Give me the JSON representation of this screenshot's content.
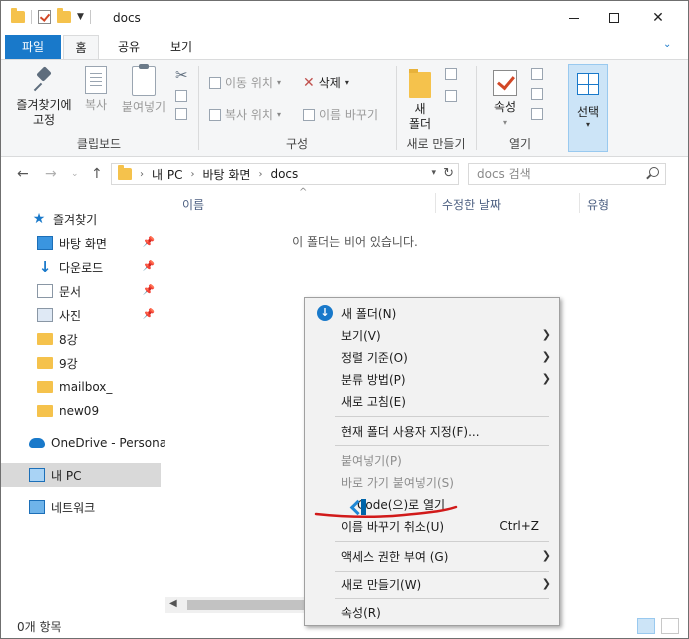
{
  "window": {
    "title": "docs"
  },
  "tabs": {
    "file": "파일",
    "home": "홈",
    "share": "공유",
    "view": "보기"
  },
  "ribbon": {
    "clipboard": {
      "group_label": "클립보드",
      "pin_label_line1": "즐겨찾기에",
      "pin_label_line2": "고정",
      "copy": "복사",
      "paste": "붙여넣기"
    },
    "organize": {
      "group_label": "구성",
      "move_to": "이동 위치",
      "copy_to": "복사 위치",
      "delete": "삭제",
      "rename": "이름 바꾸기"
    },
    "new": {
      "group_label": "새로 만들기",
      "new_folder_line1": "새",
      "new_folder_line2": "폴더"
    },
    "open": {
      "group_label": "열기",
      "properties": "속성"
    },
    "select": {
      "label": "선택"
    }
  },
  "address": {
    "path": [
      "내 PC",
      "바탕 화면",
      "docs"
    ],
    "search_placeholder": "docs 검색"
  },
  "navpane": {
    "quick_access": "즐겨찾기",
    "items": [
      {
        "label": "바탕 화면",
        "icon": "desktop-icon",
        "pinned": true
      },
      {
        "label": "다운로드",
        "icon": "download-icon",
        "pinned": true
      },
      {
        "label": "문서",
        "icon": "documents-icon",
        "pinned": true
      },
      {
        "label": "사진",
        "icon": "pictures-icon",
        "pinned": true
      },
      {
        "label": "8강",
        "icon": "folder-icon",
        "pinned": false
      },
      {
        "label": "9강",
        "icon": "folder-icon",
        "pinned": false
      },
      {
        "label": "mailbox_",
        "icon": "folder-icon",
        "pinned": false
      },
      {
        "label": "new09",
        "icon": "folder-icon",
        "pinned": false
      }
    ],
    "onedrive": "OneDrive - Personal",
    "this_pc": "내 PC",
    "network": "네트워크"
  },
  "content": {
    "columns": {
      "name": "이름",
      "modified": "수정한 날짜",
      "type": "유형"
    },
    "empty_message": "이 폴더는 비어 있습니다."
  },
  "status": {
    "item_count": "0개 항목"
  },
  "context_menu": {
    "new_folder": "새 폴더(N)",
    "view": "보기(V)",
    "sort_by": "정렬 기준(O)",
    "group_by": "분류 방법(P)",
    "refresh": "새로 고침(E)",
    "customize": "현재 폴더 사용자 지정(F)...",
    "paste": "붙여넣기(P)",
    "paste_shortcut": "바로 가기 붙여넣기(S)",
    "open_with_code": "Code(으)로 열기",
    "undo_rename": "이름 바꾸기 취소(U)",
    "undo_shortcut": "Ctrl+Z",
    "give_access": "액세스 권한 부여 (G)",
    "new": "새로 만들기(W)",
    "properties": "속성(R)"
  },
  "colors": {
    "accent": "#1979ca",
    "folder": "#f5c24c",
    "annotation": "#d11a1a"
  }
}
